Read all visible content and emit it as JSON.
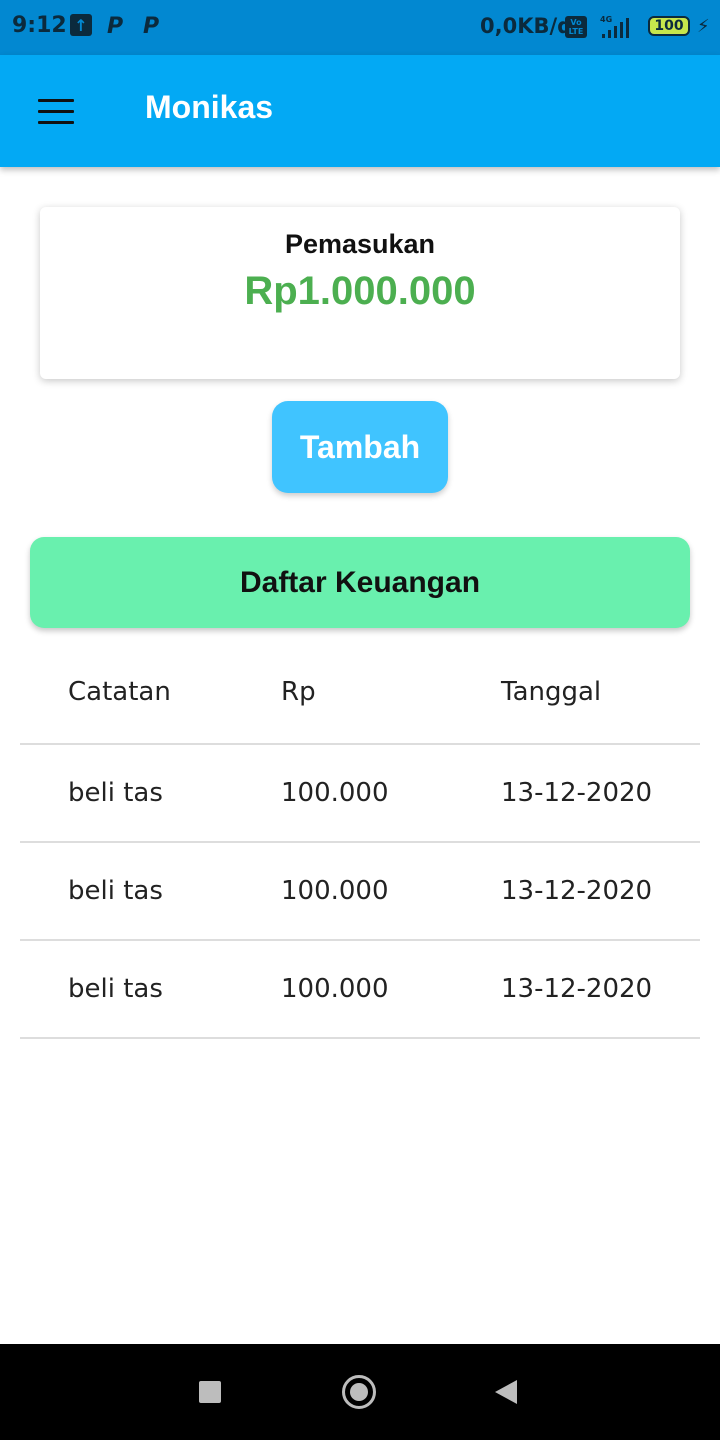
{
  "status_bar": {
    "time": "9:12",
    "notif_icons": [
      "upload-icon",
      "p-icon",
      "p-icon"
    ],
    "p_letter": "P",
    "net_speed": "0,0KB/d",
    "volte_top": "Vo",
    "volte_bottom": "LTE",
    "network": "4G",
    "battery": "100",
    "charging_icon": "⚡"
  },
  "app_bar": {
    "title": "Monikas",
    "menu_icon": "hamburger-menu-icon"
  },
  "income_card": {
    "label": "Pemasukan",
    "value": "Rp1.000.000",
    "value_color": "#4caf50"
  },
  "add_button": {
    "label": "Tambah"
  },
  "list_header": {
    "title": "Daftar Keuangan"
  },
  "table": {
    "columns": [
      "Catatan",
      "Rp",
      "Tanggal"
    ],
    "rows": [
      [
        "beli tas",
        "100.000",
        "13-12-2020"
      ],
      [
        "beli tas",
        "100.000",
        "13-12-2020"
      ],
      [
        "beli tas",
        "100.000",
        "13-12-2020"
      ]
    ]
  },
  "nav_bar": {
    "icons": [
      "recents-square-icon",
      "home-circle-icon",
      "back-triangle-icon"
    ]
  },
  "colors": {
    "app_bar": "#03a9f4",
    "status_bar": "#0288d1",
    "add_button": "#40c4ff",
    "list_header": "#69f0ae"
  }
}
